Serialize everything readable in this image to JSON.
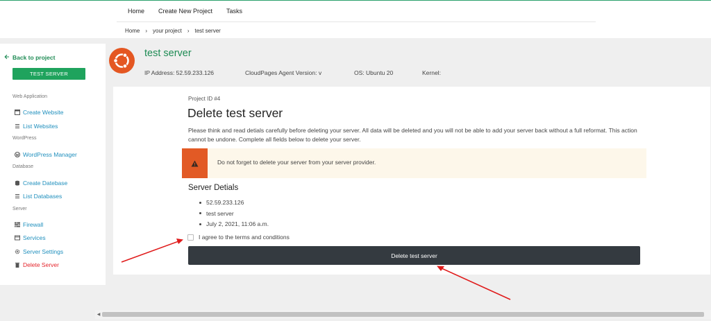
{
  "nav": {
    "items": [
      "Home",
      "Create New Project",
      "Tasks"
    ]
  },
  "breadcrumb": {
    "items": [
      "Home",
      "your project",
      "test server"
    ],
    "separator": "›"
  },
  "sidebar": {
    "back_label": "Back to project",
    "server_button": "TEST SERVER",
    "sections": {
      "web_application": "Web Application",
      "wordpress": "WordPress",
      "database": "Database",
      "server": "Server"
    },
    "items": {
      "create_website": "Create Website",
      "list_websites": "List Websites",
      "wordpress_manager": "WordPress Manager",
      "create_database": "Create Datebase",
      "list_databases": "List Databases",
      "firewall": "Firewall",
      "services": "Services",
      "server_settings": "Server Settings",
      "delete_server": "Delete Server"
    }
  },
  "server": {
    "title": "test server",
    "ip": "IP Address: 52.59.233.126",
    "agent": "CloudPages Agent Version: v",
    "os": "OS: Ubuntu 20",
    "kernel": "Kernel:"
  },
  "main": {
    "project_id": "Project ID #4",
    "heading": "Delete test server",
    "description": "Please think and read detials carefully before deleting your server. All data will be deleted and you will not be able to add your server back without a full reformat. This action cannot be undone. Complete all fields below to delete your server.",
    "alert": "Do not forget to delete your server from your server provider.",
    "details_heading": "Server Detials",
    "details": [
      "52.59.233.126",
      "test server",
      "July 2, 2021, 11:06 a.m."
    ],
    "agree_label": "I agree to the terms and conditions",
    "agree_checked": false,
    "delete_button": "Delete test server"
  },
  "colors": {
    "brand_green": "#1fa35d",
    "link_blue": "#1f8fbd",
    "danger_red": "#e4242b",
    "ubuntu_orange": "#e45722",
    "alert_orange": "#e25a25",
    "dark_button": "#343a40",
    "annotation_arrow": "#e01b1b"
  }
}
